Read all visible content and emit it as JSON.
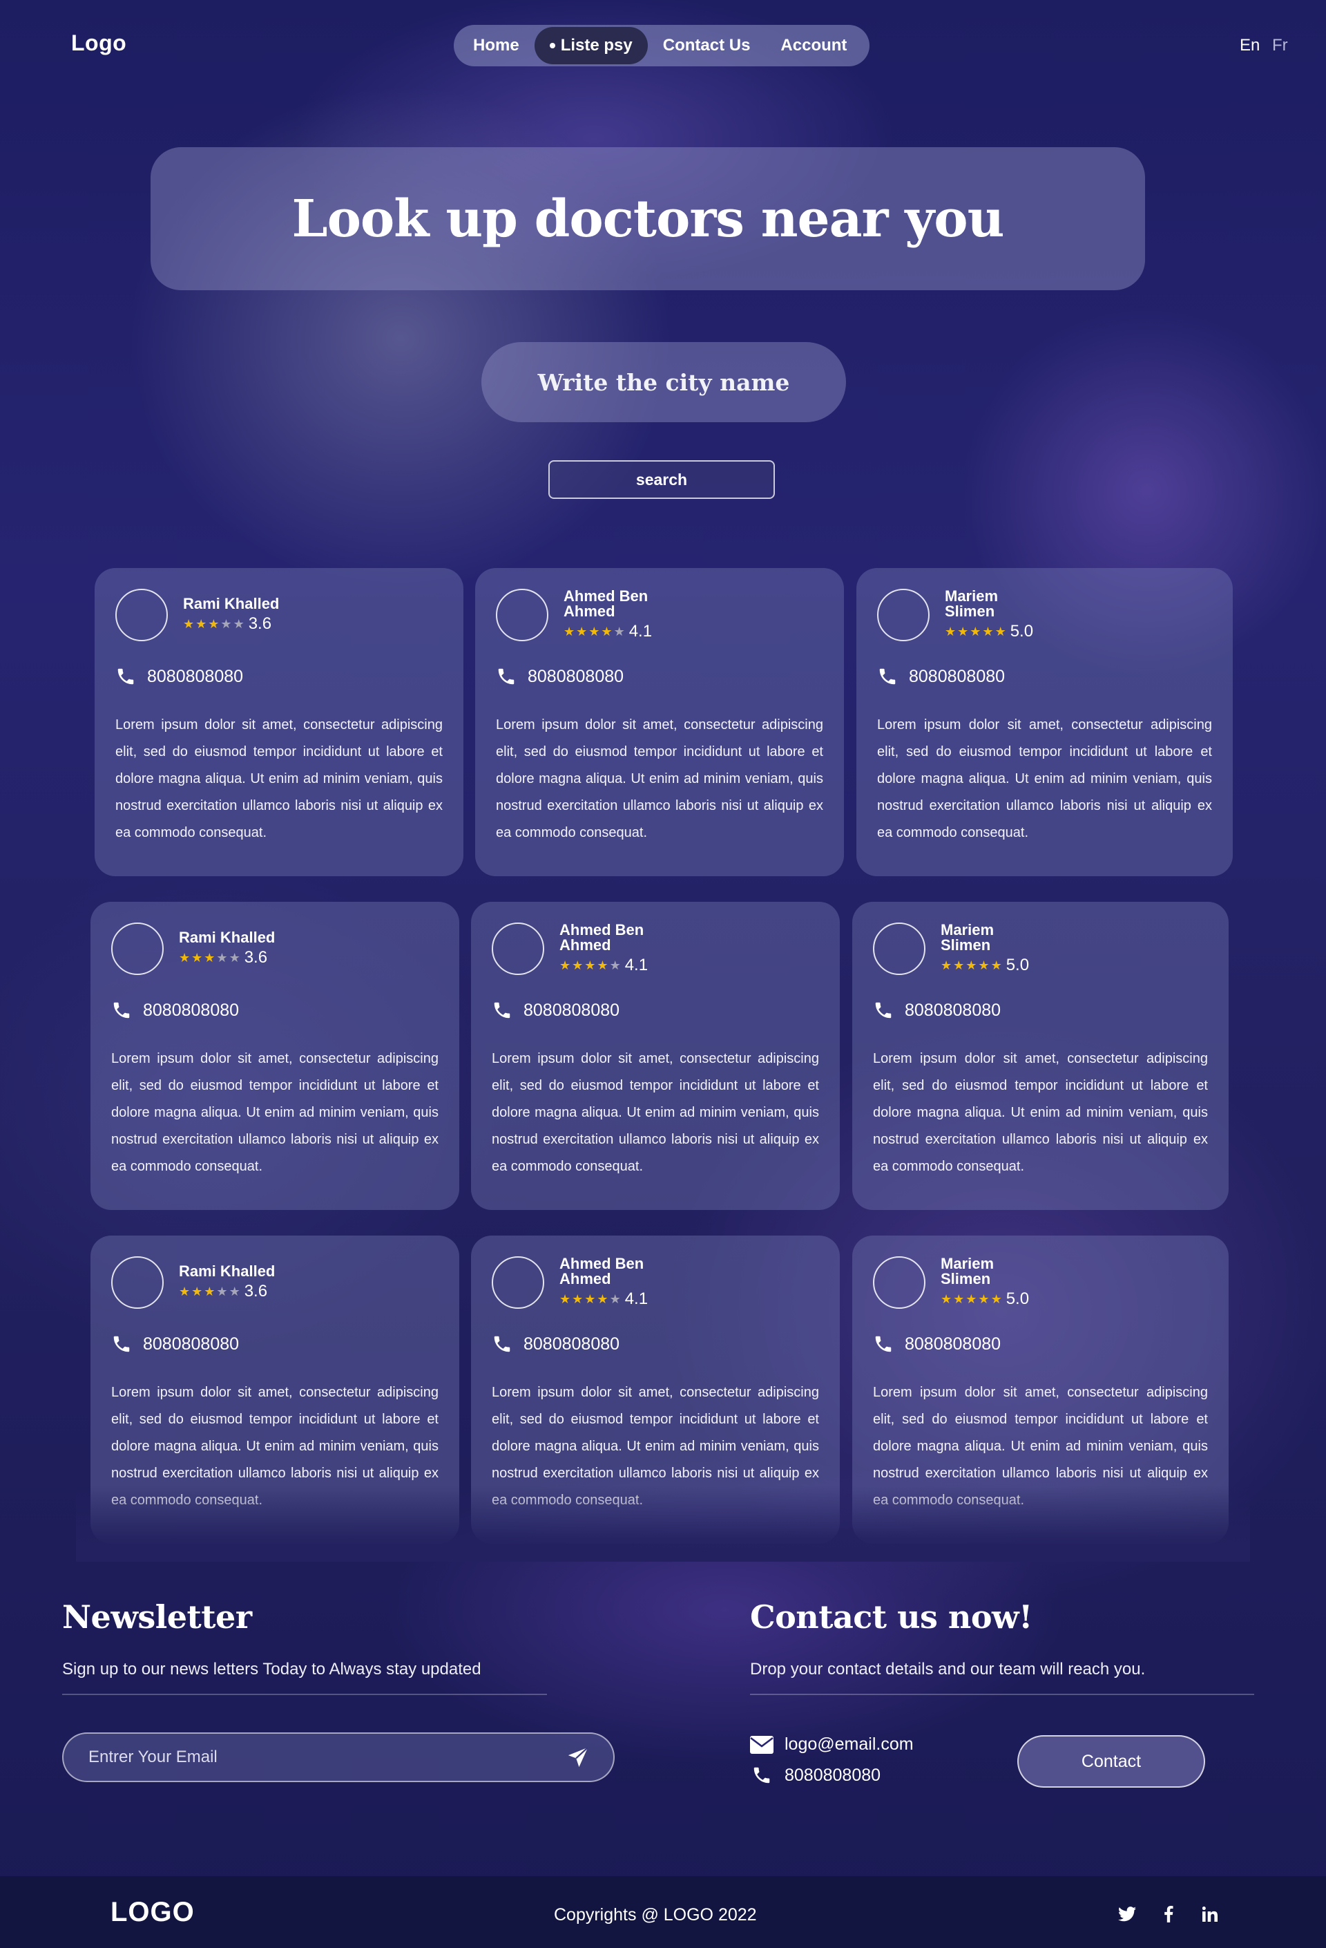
{
  "header": {
    "logo": "Logo",
    "nav": [
      {
        "label": "Home"
      },
      {
        "label": "Liste psy"
      },
      {
        "label": "Contact Us"
      },
      {
        "label": "Account"
      }
    ],
    "active_nav": "Liste psy",
    "languages": [
      "En",
      "Fr"
    ],
    "active_language": "En"
  },
  "hero": {
    "title": "Look up doctors near you",
    "city_placeholder": "Write the city name",
    "search_label": "search"
  },
  "doctors": [
    {
      "name": "Rami Khalled",
      "rating": "3.6",
      "stars": 3,
      "phone": "8080808080",
      "description": "Lorem ipsum dolor sit amet, consectetur adipiscing elit, sed do eiusmod tempor incididunt ut labore et dolore magna aliqua. Ut enim ad minim veniam, quis nostrud exercitation ullamco laboris nisi ut aliquip ex ea commodo consequat."
    },
    {
      "name": "Ahmed Ben Ahmed",
      "rating": "4.1",
      "stars": 4,
      "phone": "8080808080",
      "description": "Lorem ipsum dolor sit amet, consectetur adipiscing elit, sed do eiusmod tempor incididunt ut labore et dolore magna aliqua. Ut enim ad minim veniam, quis nostrud exercitation ullamco laboris nisi ut aliquip ex ea commodo consequat."
    },
    {
      "name": "Mariem Slimen",
      "rating": "5.0",
      "stars": 5,
      "phone": "8080808080",
      "description": "Lorem ipsum dolor sit amet, consectetur adipiscing elit, sed do eiusmod tempor incididunt ut labore et dolore magna aliqua. Ut enim ad minim veniam, quis nostrud exercitation ullamco laboris nisi ut aliquip ex ea commodo consequat."
    },
    {
      "name": "Rami Khalled",
      "rating": "3.6",
      "stars": 3,
      "phone": "8080808080",
      "description": "Lorem ipsum dolor sit amet, consectetur adipiscing elit, sed do eiusmod tempor incididunt ut labore et dolore magna aliqua. Ut enim ad minim veniam, quis nostrud exercitation ullamco laboris nisi ut aliquip ex ea commodo consequat."
    },
    {
      "name": "Ahmed Ben Ahmed",
      "rating": "4.1",
      "stars": 4,
      "phone": "8080808080",
      "description": "Lorem ipsum dolor sit amet, consectetur adipiscing elit, sed do eiusmod tempor incididunt ut labore et dolore magna aliqua. Ut enim ad minim veniam, quis nostrud exercitation ullamco laboris nisi ut aliquip ex ea commodo consequat."
    },
    {
      "name": "Mariem Slimen",
      "rating": "5.0",
      "stars": 5,
      "phone": "8080808080",
      "description": "Lorem ipsum dolor sit amet, consectetur adipiscing elit, sed do eiusmod tempor incididunt ut labore et dolore magna aliqua. Ut enim ad minim veniam, quis nostrud exercitation ullamco laboris nisi ut aliquip ex ea commodo consequat."
    },
    {
      "name": "Rami Khalled",
      "rating": "3.6",
      "stars": 3,
      "phone": "8080808080",
      "description": "Lorem ipsum dolor sit amet, consectetur adipiscing elit, sed do eiusmod tempor incididunt ut labore et dolore magna aliqua. Ut enim ad minim veniam, quis nostrud exercitation ullamco laboris nisi ut aliquip ex ea commodo consequat."
    },
    {
      "name": "Ahmed Ben Ahmed",
      "rating": "4.1",
      "stars": 4,
      "phone": "8080808080",
      "description": "Lorem ipsum dolor sit amet, consectetur adipiscing elit, sed do eiusmod tempor incididunt ut labore et dolore magna aliqua. Ut enim ad minim veniam, quis nostrud exercitation ullamco laboris nisi ut aliquip ex ea commodo consequat."
    },
    {
      "name": "Mariem Slimen",
      "rating": "5.0",
      "stars": 5,
      "phone": "8080808080",
      "description": "Lorem ipsum dolor sit amet, consectetur adipiscing elit, sed do eiusmod tempor incididunt ut labore et dolore magna aliqua. Ut enim ad minim veniam, quis nostrud exercitation ullamco laboris nisi ut aliquip ex ea commodo consequat."
    }
  ],
  "newsletter": {
    "title": "Newsletter",
    "subtitle": "Sign up to our news letters Today to Always stay updated",
    "email_placeholder": "Entrer Your Email"
  },
  "contact": {
    "title": "Contact us now!",
    "subtitle": "Drop your contact details and our team will reach you.",
    "email": "logo@email.com",
    "phone": "8080808080",
    "button_label": "Contact"
  },
  "footer": {
    "logo": "LOGO",
    "copyright": "Copyrights @ LOGO 2022",
    "social": [
      "twitter-icon",
      "facebook-icon",
      "linkedin-icon"
    ]
  },
  "colors": {
    "star_on": "#f0b90b",
    "star_off": "#a6a6b8",
    "footer_bg": "#121540"
  }
}
